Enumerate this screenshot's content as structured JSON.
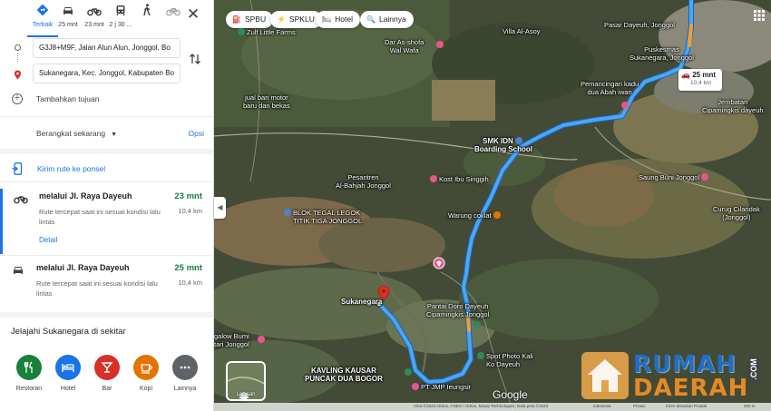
{
  "travel_modes": [
    {
      "label": "Terbaik",
      "icon": "diamond-directions-icon",
      "active": true
    },
    {
      "label": "25 mnt",
      "icon": "car-icon"
    },
    {
      "label": "23 mnt",
      "icon": "motorcycle-icon"
    },
    {
      "label": "2 j 30 ...",
      "icon": "transit-icon"
    },
    {
      "label": "",
      "icon": "walk-icon"
    },
    {
      "label": "",
      "icon": "bicycle-icon"
    }
  ],
  "origin": "G3J8+M9F, Jalan Alun Alun, Jonggol, Bo",
  "destination": "Sukanegara, Kec. Jonggol, Kabupaten Bo",
  "add_destination": "Tambahkan tujuan",
  "depart_label": "Berangkat sekarang",
  "options_label": "Opsi",
  "send_to_phone": "Kirim rute ke ponsel",
  "routes": [
    {
      "name": "melalui Jl. Raya Dayeuh",
      "time": "23 mnt",
      "desc": "Rute tercepat saat ini sesuai kondisi lalu lintas",
      "distance": "10,4 km",
      "detail": "Detail",
      "mode": "motorcycle-icon"
    },
    {
      "name": "melalui Jl. Raya Dayeuh",
      "time": "25 mnt",
      "desc": "Rute tercepat saat ini sesuai kondisi lalu lintas",
      "distance": "10,4 km",
      "mode": "car-icon"
    }
  ],
  "explore_title": "Jelajahi Sukanegara di sekitar",
  "categories": [
    {
      "label": "Restoran",
      "color": "#188038",
      "icon": "restaurant-icon"
    },
    {
      "label": "Hotel",
      "color": "#1a73e8",
      "icon": "hotel-icon"
    },
    {
      "label": "Bar",
      "color": "#d93025",
      "icon": "bar-icon"
    },
    {
      "label": "Kopi",
      "color": "#e37400",
      "icon": "coffee-icon"
    },
    {
      "label": "Lainnya",
      "color": "#5f6368",
      "icon": "more-icon"
    }
  ],
  "map_chips": [
    {
      "label": "SPBU",
      "icon": "gas-station-icon"
    },
    {
      "label": "SPKLU",
      "icon": "ev-charger-icon"
    },
    {
      "label": "Hotel",
      "icon": "hotel-icon"
    },
    {
      "label": "Lainnya",
      "icon": "search-icon"
    }
  ],
  "route_badge": {
    "time": "25 mnt",
    "distance": "10,4 km"
  },
  "map_labels": {
    "zulf": "Zulf Little Farms",
    "darshofa1": "Dar As-shofa",
    "darshofa2": "Wal Wafa",
    "villa": "Villa Al-Asoy",
    "pasar": "Pasar Dayeuh, Jonggol",
    "puskesmas1": "Puskesmas",
    "puskesmas2": "Sukanegara, Jonggol",
    "pemancingan1": "Pemancingan kadu",
    "pemancingan2": "dua Abah iwan",
    "jembatan1": "Jembatan",
    "jembatan2": "Cipamingkis dayeuh",
    "jual1": "jual ban motor",
    "jual2": "baru dan bekas",
    "smk1": "SMK IDN",
    "smk2": "Boarding School",
    "pesantren1": "Pesantren",
    "pesantren2": "Al-Bahjah Jonggol",
    "kost": "Kost Ibu Singgih",
    "saung": "Saung Buni Jonggol",
    "blok1": "BLOK TEGAL LEGOK",
    "blok2": "TITIK TIGA JONGGOL",
    "warung": "Warung coklat",
    "curug1": "Curug Cilandak",
    "curug2": "(Jonggol)",
    "sukanegara": "Sukanegara",
    "pantai1": "Pantai Doro Dayeuh",
    "pantai2": "Cipamingkis Jonggol",
    "galow1": "galow Bumi",
    "galow2": "tari Jonggol",
    "spot1": "Spot Photo Kali",
    "spot2": "Ko Dayeuh",
    "kavling1": "KAVLING KAUSAR",
    "kavling2": "PUNCAK DUA BOGOR",
    "jmp": "PT JMP Ieungsir"
  },
  "layers_label": "Lapisan",
  "google_logo": "Google",
  "attribution": [
    "Citra ©2023 Airbus, CNES / Airbus, Maxar Technologies, Data peta ©2023",
    "Indonesia",
    "Privasi",
    "Kirim Masukan Produk",
    "200 m"
  ],
  "watermark": {
    "line1": "RUMAH",
    "line2": "DAERAH",
    "suffix": ".COM"
  },
  "colors": {
    "accent": "#1a73e8",
    "route": "#4aa8f0",
    "time_green": "#188038",
    "watermark_blue": "#1e6fc8",
    "watermark_orange": "#e58a24"
  }
}
